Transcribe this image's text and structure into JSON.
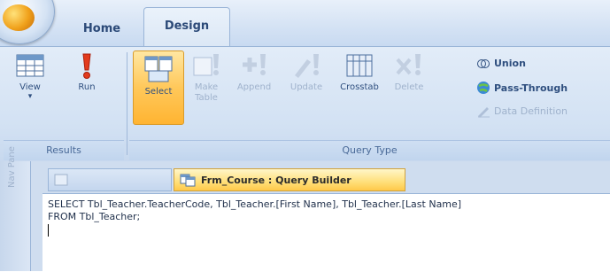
{
  "tabs": {
    "home": "Home",
    "design": "Design"
  },
  "ribbon": {
    "results": {
      "title": "Results",
      "view": "View",
      "run": "Run"
    },
    "query_type": {
      "title": "Query Type",
      "select": "Select",
      "make_table": "Make\nTable",
      "append": "Append",
      "update": "Update",
      "crosstab": "Crosstab",
      "delete": "Delete",
      "union": "Union",
      "pass_through": "Pass-Through",
      "data_definition": "Data Definition"
    }
  },
  "nav_pane": {
    "label": "Nav Pane"
  },
  "doc_tabs": {
    "inactive": "",
    "active": "Frm_Course : Query Builder"
  },
  "editor": {
    "line1": "SELECT Tbl_Teacher.TeacherCode, Tbl_Teacher.[First Name], Tbl_Teacher.[Last Name]",
    "line2": "FROM Tbl_Teacher;"
  },
  "colors": {
    "accent": "#ffc94a",
    "ribbon": "#d2e1f3",
    "text": "#2f4f7f"
  }
}
